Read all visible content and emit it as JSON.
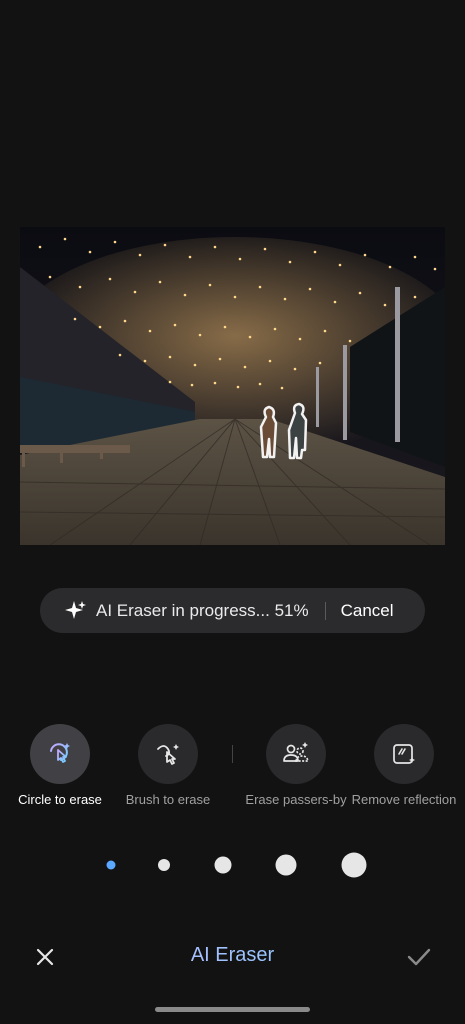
{
  "progress": {
    "status_text": "AI Eraser in progress... 51%",
    "percent": 51,
    "cancel_label": "Cancel",
    "icon": "ai-sparkle-icon"
  },
  "tools": [
    {
      "label": "Circle to erase",
      "icon": "circle-erase-icon",
      "active": true
    },
    {
      "label": "Brush to erase",
      "icon": "brush-erase-icon",
      "active": false
    },
    {
      "label": "Erase passers-by",
      "icon": "passers-by-icon",
      "active": false
    },
    {
      "label": "Remove reflection",
      "icon": "reflection-icon",
      "active": false
    }
  ],
  "brush_sizes": {
    "count": 5,
    "selected_index": 0,
    "accent": "#5aa8ff"
  },
  "bottom_bar": {
    "title": "AI Eraser",
    "close_icon": "close-icon",
    "confirm_icon": "check-icon"
  },
  "colors": {
    "background": "#121212",
    "pill": "#2b2b2d",
    "title_gradient": [
      "#c8b4ff",
      "#7fe0ff"
    ]
  }
}
